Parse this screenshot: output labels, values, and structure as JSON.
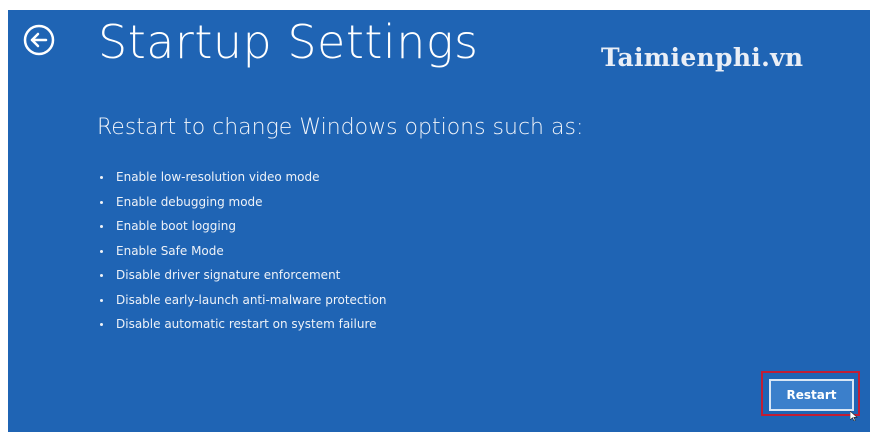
{
  "page": {
    "title": "Startup Settings",
    "watermark": "Taimienphi.vn",
    "subtitle": "Restart to change Windows options such as:"
  },
  "options": [
    "Enable low-resolution video mode",
    "Enable debugging mode",
    "Enable boot logging",
    "Enable Safe Mode",
    "Disable driver signature enforcement",
    "Disable early-launch anti-malware protection",
    "Disable automatic restart on system failure"
  ],
  "actions": {
    "restart_label": "Restart"
  },
  "icons": {
    "back": "back-arrow-circle-icon",
    "cursor": "mouse-pointer-icon"
  },
  "colors": {
    "background": "#1f64b4",
    "highlight": "#c21d34",
    "button": "#3b7fcb"
  }
}
